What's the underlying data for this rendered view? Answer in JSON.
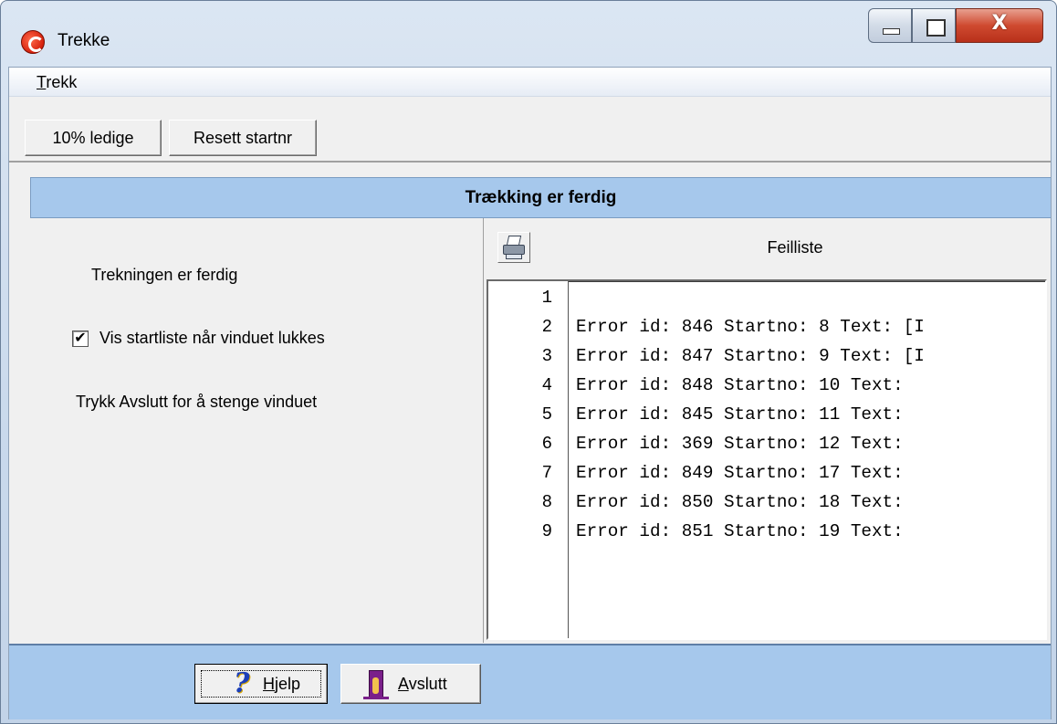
{
  "window": {
    "title": "Trekke",
    "close_glyph": "X",
    "controls": [
      "minimize-icon",
      "maximize-icon",
      "close-icon"
    ],
    "app_icon": "app-logo-icon"
  },
  "menu": {
    "items": [
      {
        "label_prefix": "T",
        "label_rest": "rekk"
      }
    ]
  },
  "toolbar": {
    "buttons": [
      "10% ledige",
      "Resett startnr"
    ]
  },
  "banner": {
    "title": "Trækking er ferdig"
  },
  "left": {
    "status_text": "Trekningen er ferdig",
    "checkbox_label": "Vis startliste når vinduet lukkes",
    "checkbox_checked": true,
    "check_glyph": "✔",
    "hint_text": "Trykk Avslutt for å stenge vinduet"
  },
  "right": {
    "print_icon": "printer-icon",
    "title": "Feilliste",
    "line_numbers": [
      "1",
      "2",
      "3",
      "4",
      "5",
      "6",
      "7",
      "8",
      "9"
    ],
    "lines": [
      "",
      "Error id: 846 Startno: 8 Text: [I",
      "Error id: 847 Startno: 9 Text: [I",
      "Error id: 848 Startno: 10 Text:",
      "Error id: 845 Startno: 11 Text:",
      "Error id: 369 Startno: 12 Text:",
      "Error id: 849 Startno: 17 Text:",
      "Error id: 850 Startno: 18 Text:",
      "Error id: 851 Startno: 19 Text:"
    ]
  },
  "footer": {
    "help": {
      "icon": "help-icon",
      "glyph": "?",
      "hotkey": "H",
      "rest": "jelp"
    },
    "exit": {
      "icon": "exit-door-icon",
      "hotkey": "A",
      "rest": "vslutt"
    }
  },
  "colors": {
    "banner_bg": "#a6c8ec",
    "client_bg": "#f0f0f0",
    "close_button": "#cf4a30"
  }
}
